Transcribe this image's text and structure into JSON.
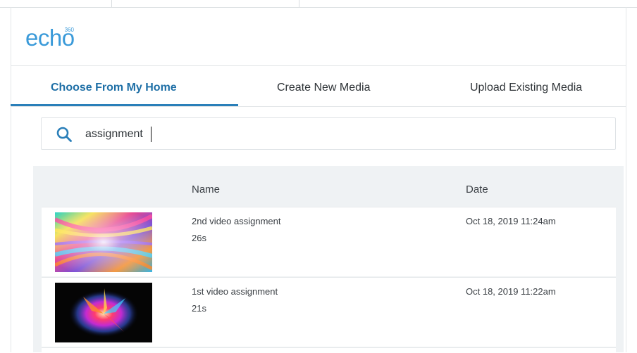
{
  "brand": {
    "logo_text": "echo",
    "logo_superscript": "360",
    "color": "#3a9ad9"
  },
  "tabs": [
    {
      "label": "Choose From My Home",
      "active": true
    },
    {
      "label": "Create New Media",
      "active": false
    },
    {
      "label": "Upload Existing Media",
      "active": false
    }
  ],
  "search": {
    "value": "assignment",
    "icon": "search-icon"
  },
  "table": {
    "columns": {
      "name": "Name",
      "date": "Date"
    },
    "rows": [
      {
        "title": "2nd video assignment",
        "duration": "26s",
        "date": "Oct 18, 2019 11:24am",
        "thumbnail": "colorful-swirl"
      },
      {
        "title": "1st video assignment",
        "duration": "21s",
        "date": "Oct 18, 2019 11:22am",
        "thumbnail": "color-splash"
      }
    ]
  },
  "colors": {
    "accent": "#2a7fb9",
    "active_tab_text": "#1e6fa6",
    "panel_bg": "#eff2f4"
  }
}
